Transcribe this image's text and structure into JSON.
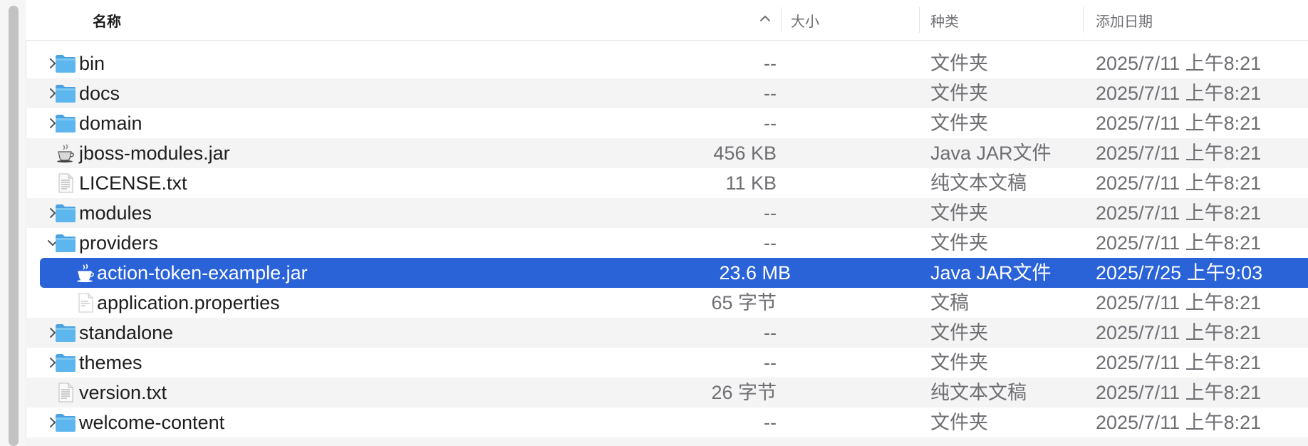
{
  "header": {
    "name": "名称",
    "size": "大小",
    "kind": "种类",
    "date": "添加日期"
  },
  "colors": {
    "selection": "#2a62d8",
    "folder": "#5eb6ee",
    "alt_row": "#f4f4f5"
  },
  "rows": [
    {
      "name": "bin",
      "size": "--",
      "kind": "文件夹",
      "date": "2025/7/11 上午8:21",
      "icon": "folder-icon",
      "expandable": true,
      "expanded": false,
      "indent": 0,
      "alt": false,
      "selected": false
    },
    {
      "name": "docs",
      "size": "--",
      "kind": "文件夹",
      "date": "2025/7/11 上午8:21",
      "icon": "folder-icon",
      "expandable": true,
      "expanded": false,
      "indent": 0,
      "alt": true,
      "selected": false
    },
    {
      "name": "domain",
      "size": "--",
      "kind": "文件夹",
      "date": "2025/7/11 上午8:21",
      "icon": "folder-icon",
      "expandable": true,
      "expanded": false,
      "indent": 0,
      "alt": false,
      "selected": false
    },
    {
      "name": "jboss-modules.jar",
      "size": "456 KB",
      "kind": "Java JAR文件",
      "date": "2025/7/11 上午8:21",
      "icon": "java-jar-icon",
      "expandable": false,
      "expanded": false,
      "indent": 0,
      "alt": true,
      "selected": false
    },
    {
      "name": "LICENSE.txt",
      "size": "11 KB",
      "kind": "纯文本文稿",
      "date": "2025/7/11 上午8:21",
      "icon": "text-file-icon",
      "expandable": false,
      "expanded": false,
      "indent": 0,
      "alt": false,
      "selected": false
    },
    {
      "name": "modules",
      "size": "--",
      "kind": "文件夹",
      "date": "2025/7/11 上午8:21",
      "icon": "folder-icon",
      "expandable": true,
      "expanded": false,
      "indent": 0,
      "alt": true,
      "selected": false
    },
    {
      "name": "providers",
      "size": "--",
      "kind": "文件夹",
      "date": "2025/7/11 上午8:21",
      "icon": "folder-icon",
      "expandable": true,
      "expanded": true,
      "indent": 0,
      "alt": false,
      "selected": false
    },
    {
      "name": "action-token-example.jar",
      "size": "23.6 MB",
      "kind": "Java JAR文件",
      "date": "2025/7/25 上午9:03",
      "icon": "java-jar-icon",
      "expandable": false,
      "expanded": false,
      "indent": 1,
      "alt": false,
      "selected": true
    },
    {
      "name": "application.properties",
      "size": "65 字节",
      "kind": "文稿",
      "date": "2025/7/11 上午8:21",
      "icon": "document-icon",
      "expandable": false,
      "expanded": false,
      "indent": 1,
      "alt": false,
      "selected": false
    },
    {
      "name": "standalone",
      "size": "--",
      "kind": "文件夹",
      "date": "2025/7/11 上午8:21",
      "icon": "folder-icon",
      "expandable": true,
      "expanded": false,
      "indent": 0,
      "alt": true,
      "selected": false
    },
    {
      "name": "themes",
      "size": "--",
      "kind": "文件夹",
      "date": "2025/7/11 上午8:21",
      "icon": "folder-icon",
      "expandable": true,
      "expanded": false,
      "indent": 0,
      "alt": false,
      "selected": false
    },
    {
      "name": "version.txt",
      "size": "26 字节",
      "kind": "纯文本文稿",
      "date": "2025/7/11 上午8:21",
      "icon": "text-file-icon",
      "expandable": false,
      "expanded": false,
      "indent": 0,
      "alt": true,
      "selected": false
    },
    {
      "name": "welcome-content",
      "size": "--",
      "kind": "文件夹",
      "date": "2025/7/11 上午8:21",
      "icon": "folder-icon",
      "expandable": true,
      "expanded": false,
      "indent": 0,
      "alt": false,
      "selected": false
    }
  ]
}
